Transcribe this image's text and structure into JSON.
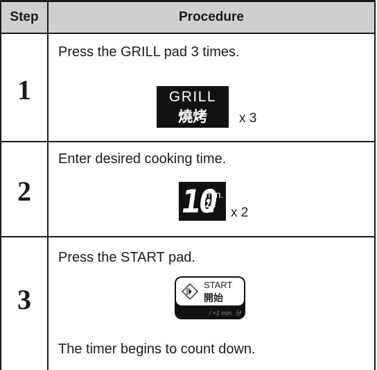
{
  "header": {
    "step": "Step",
    "procedure": "Procedure"
  },
  "rows": [
    {
      "step": "1",
      "text": "Press the GRILL pad 3 times.",
      "key": {
        "line1": "GRILL",
        "line2": "燒烤"
      },
      "multiplier": "x 3"
    },
    {
      "step": "2",
      "text": "Enter desired cooking time.",
      "key": {
        "digits": "10",
        "unit": "min.",
        "unit_zh": "分"
      },
      "multiplier": "x 2"
    },
    {
      "step": "3",
      "text": "Press the START pad.",
      "key": {
        "line1": "START",
        "line2": "開始",
        "sub": "/ +1 min. 分"
      },
      "note": "The timer begins to count down."
    }
  ]
}
